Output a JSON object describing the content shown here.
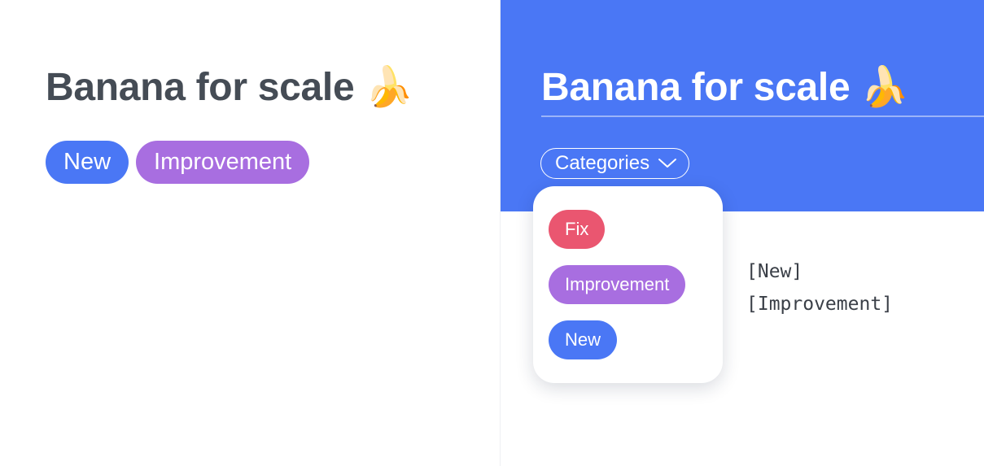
{
  "left": {
    "title": "Banana for scale 🍌",
    "tags": [
      {
        "label": "New",
        "color": "#4a77f5"
      },
      {
        "label": "Improvement",
        "color": "#a86ee0"
      }
    ]
  },
  "right": {
    "title": "Banana for scale 🍌",
    "categories_label": "Categories",
    "banner_color": "#4a77f5",
    "dropdown": {
      "options": [
        {
          "label": "Fix",
          "color": "#ea5670"
        },
        {
          "label": "Improvement",
          "color": "#a86ee0"
        },
        {
          "label": "New",
          "color": "#4a77f5"
        }
      ]
    },
    "output_lines": [
      "[New]",
      "[Improvement]"
    ]
  }
}
